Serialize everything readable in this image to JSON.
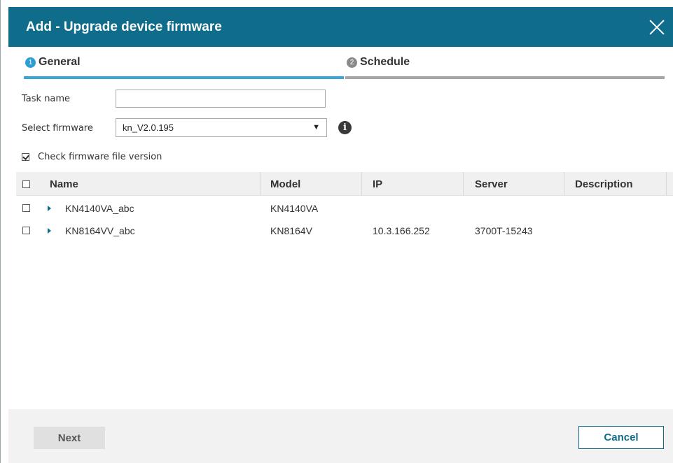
{
  "dialog": {
    "title": "Add - Upgrade device firmware"
  },
  "steps": [
    {
      "number": "1",
      "label": "General",
      "active": true
    },
    {
      "number": "2",
      "label": "Schedule",
      "active": false
    }
  ],
  "form": {
    "task_name_label": "Task name",
    "task_name_value": "",
    "select_firmware_label": "Select firmware",
    "firmware_selected": "kn_V2.0.195",
    "check_version_label": "Check firmware file version",
    "check_version_checked": true
  },
  "table": {
    "columns": [
      "Name",
      "Model",
      "IP",
      "Server",
      "Description"
    ],
    "rows": [
      {
        "name": "KN4140VA_abc",
        "model": "KN4140VA",
        "ip": "",
        "server": "",
        "description": ""
      },
      {
        "name": "KN8164VV_abc",
        "model": "KN8164V",
        "ip": "10.3.166.252",
        "server": "3700T-15243",
        "description": ""
      }
    ]
  },
  "footer": {
    "next_label": "Next",
    "cancel_label": "Cancel"
  },
  "icons": {
    "close": "close-icon",
    "info": "info-icon",
    "expand": "chevron-right-icon"
  },
  "colors": {
    "titlebar": "#0f6c8b",
    "active_step": "#3aa5d9",
    "inactive_step": "#a6a6a6"
  }
}
